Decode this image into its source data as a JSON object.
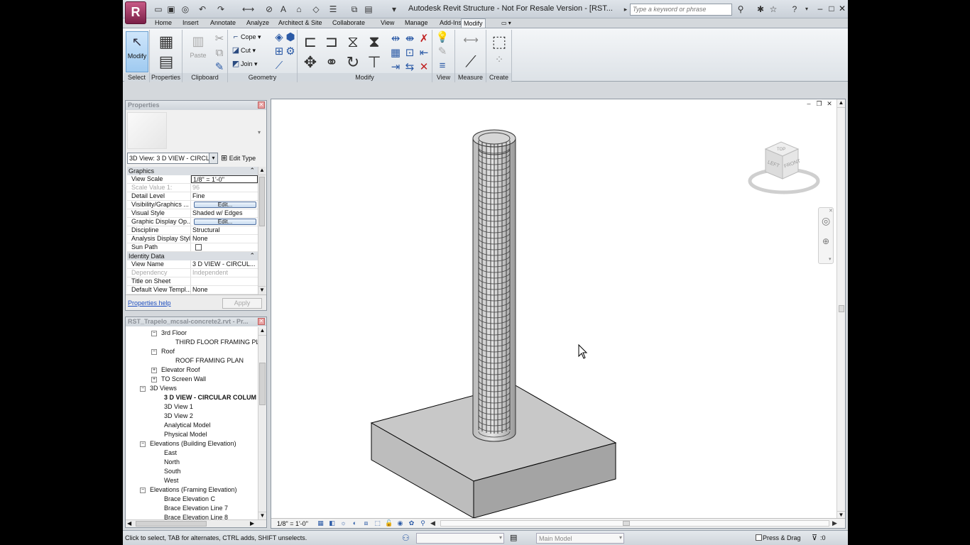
{
  "title": "Autodesk Revit Structure - Not For Resale Version - [RST...",
  "search": {
    "placeholder": "Type a keyword or phrase"
  },
  "tabs": [
    "Home",
    "Insert",
    "Annotate",
    "Analyze",
    "Architect & Site",
    "Collaborate",
    "View",
    "Manage",
    "Add-Ins",
    "Modify"
  ],
  "active_tab": "Modify",
  "ribbon": {
    "select": {
      "modify_label": "Modify",
      "panel": "Select"
    },
    "properties": {
      "panel": "Properties"
    },
    "clipboard": {
      "paste_label": "Paste",
      "panel": "Clipboard"
    },
    "geometry": {
      "cope_label": "Cope",
      "cut_label": "Cut",
      "join_label": "Join",
      "panel": "Geometry"
    },
    "modify": {
      "panel": "Modify"
    },
    "view": {
      "panel": "View"
    },
    "measure": {
      "panel": "Measure"
    },
    "create": {
      "panel": "Create"
    }
  },
  "properties": {
    "header": "Properties",
    "type_selector": "3D View: 3 D VIEW - CIRCL",
    "edit_type": "Edit Type",
    "groups": [
      {
        "name": "Graphics",
        "rows": [
          {
            "name": "View Scale",
            "value": "1/8\" = 1'-0\""
          },
          {
            "name": "Scale Value    1:",
            "value": "96"
          },
          {
            "name": "Detail Level",
            "value": "Fine"
          },
          {
            "name": "Visibility/Graphics ...",
            "value": "Edit..."
          },
          {
            "name": "Visual Style",
            "value": "Shaded w/ Edges"
          },
          {
            "name": "Graphic Display Op...",
            "value": "Edit..."
          },
          {
            "name": "Discipline",
            "value": "Structural"
          },
          {
            "name": "Analysis Display Style",
            "value": "None"
          },
          {
            "name": "Sun Path",
            "value": ""
          }
        ]
      },
      {
        "name": "Identity Data",
        "rows": [
          {
            "name": "View Name",
            "value": "3 D VIEW - CIRCUL..."
          },
          {
            "name": "Dependency",
            "value": "Independent"
          },
          {
            "name": "Title on Sheet",
            "value": ""
          },
          {
            "name": "Default View Templ...",
            "value": "None"
          }
        ]
      }
    ],
    "help_link": "Properties help",
    "apply_label": "Apply"
  },
  "browser": {
    "header": "RST_Trapelo_mcsal-concrete2.rvt - Pr...",
    "nodes": [
      {
        "label": "3rd Floor",
        "toggle": "−"
      },
      {
        "label": "THIRD FLOOR FRAMING PLA"
      },
      {
        "label": "Roof",
        "toggle": "−"
      },
      {
        "label": "ROOF FRAMING PLAN"
      },
      {
        "label": "Elevator Roof",
        "toggle": "+"
      },
      {
        "label": "TO Screen Wall",
        "toggle": "+"
      },
      {
        "label": "3D Views",
        "toggle": "−"
      },
      {
        "label": "3 D VIEW - CIRCULAR COLUM"
      },
      {
        "label": "3D View 1"
      },
      {
        "label": "3D View 2"
      },
      {
        "label": "Analytical Model"
      },
      {
        "label": "Physical Model"
      },
      {
        "label": "Elevations (Building Elevation)",
        "toggle": "−"
      },
      {
        "label": "East"
      },
      {
        "label": "North"
      },
      {
        "label": "South"
      },
      {
        "label": "West"
      },
      {
        "label": "Elevations (Framing Elevation)",
        "toggle": "−"
      },
      {
        "label": "Brace Elevation C"
      },
      {
        "label": "Brace Elevation Line 7"
      },
      {
        "label": "Brace Elevation Line 8"
      }
    ]
  },
  "view": {
    "scale": "1/8\" = 1'-0\"",
    "viewcube": {
      "front": "FRONT",
      "left": "LEFT",
      "top": "TOP"
    }
  },
  "status": {
    "hint": "Click to select, TAB for alternates, CTRL adds, SHIFT unselects.",
    "model": "Main Model",
    "press_drag": "Press & Drag",
    "filter": ":0"
  }
}
